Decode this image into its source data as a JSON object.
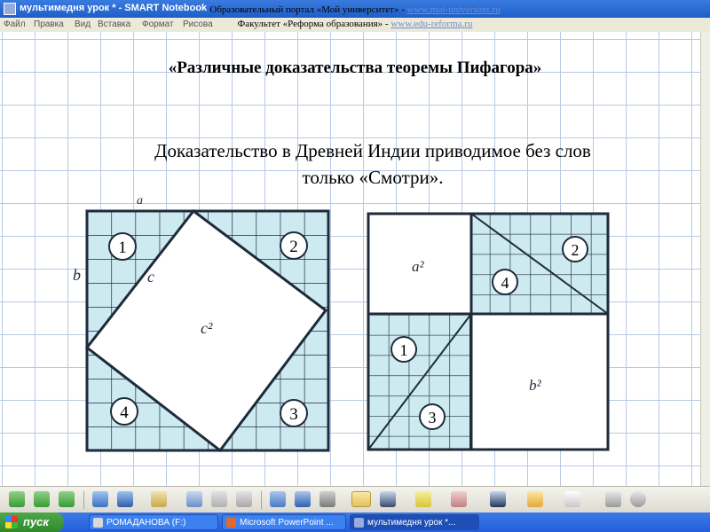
{
  "window": {
    "title": "мультимедня урок * - SMART Notebook"
  },
  "menu": {
    "items": [
      "Файл",
      "Правка",
      "Вид",
      "Вставка",
      "Формат",
      "Рисова"
    ]
  },
  "watermark": {
    "line1_text": "Образовательный портал «Мой университет» - ",
    "line1_link": "www.moi-universitet.ru",
    "line2_text": "Факультет «Реформа образования» - ",
    "line2_link": "www.edu-reforma.ru"
  },
  "slide": {
    "heading": "«Различные доказательства теоремы Пифагора»",
    "subtitle_line1": "Доказательство в Древней Индии приводимое без слов",
    "subtitle_line2": "только «Смотри»."
  },
  "figure_left": {
    "label_a": "a",
    "label_b": "b",
    "label_c": "c",
    "label_c2": "c²",
    "triangles": [
      "1",
      "2",
      "3",
      "4"
    ]
  },
  "figure_right": {
    "label_a2": "a²",
    "label_b2": "b²",
    "triangles": [
      "1",
      "2",
      "3",
      "4"
    ]
  },
  "toolbar": {
    "tools": [
      "back-icon",
      "forward-icon",
      "add-page-icon",
      "open-icon",
      "save-icon",
      "paste-icon",
      "undo-icon",
      "redo-icon",
      "delete-icon",
      "screen-shade-icon",
      "full-screen-icon",
      "camera-icon",
      "select-icon",
      "pen-icon",
      "highlighter-icon",
      "eraser-icon",
      "line-icon",
      "shapes-icon",
      "text-icon",
      "properties-icon",
      "more-icon"
    ]
  },
  "taskbar": {
    "start_label": "пуск",
    "tasks": [
      {
        "label": "РОМАДАНОВА (F:)",
        "active": false
      },
      {
        "label": "Microsoft PowerPoint ...",
        "active": false
      },
      {
        "label": "мультимедня урок *...",
        "active": true
      }
    ]
  },
  "colors": {
    "grid_line": "#b7c9e6",
    "cell_fill": "#cdeaf1",
    "taskbar": "#245edb",
    "start": "#2f8a2c",
    "link": "#6a8fd6"
  }
}
